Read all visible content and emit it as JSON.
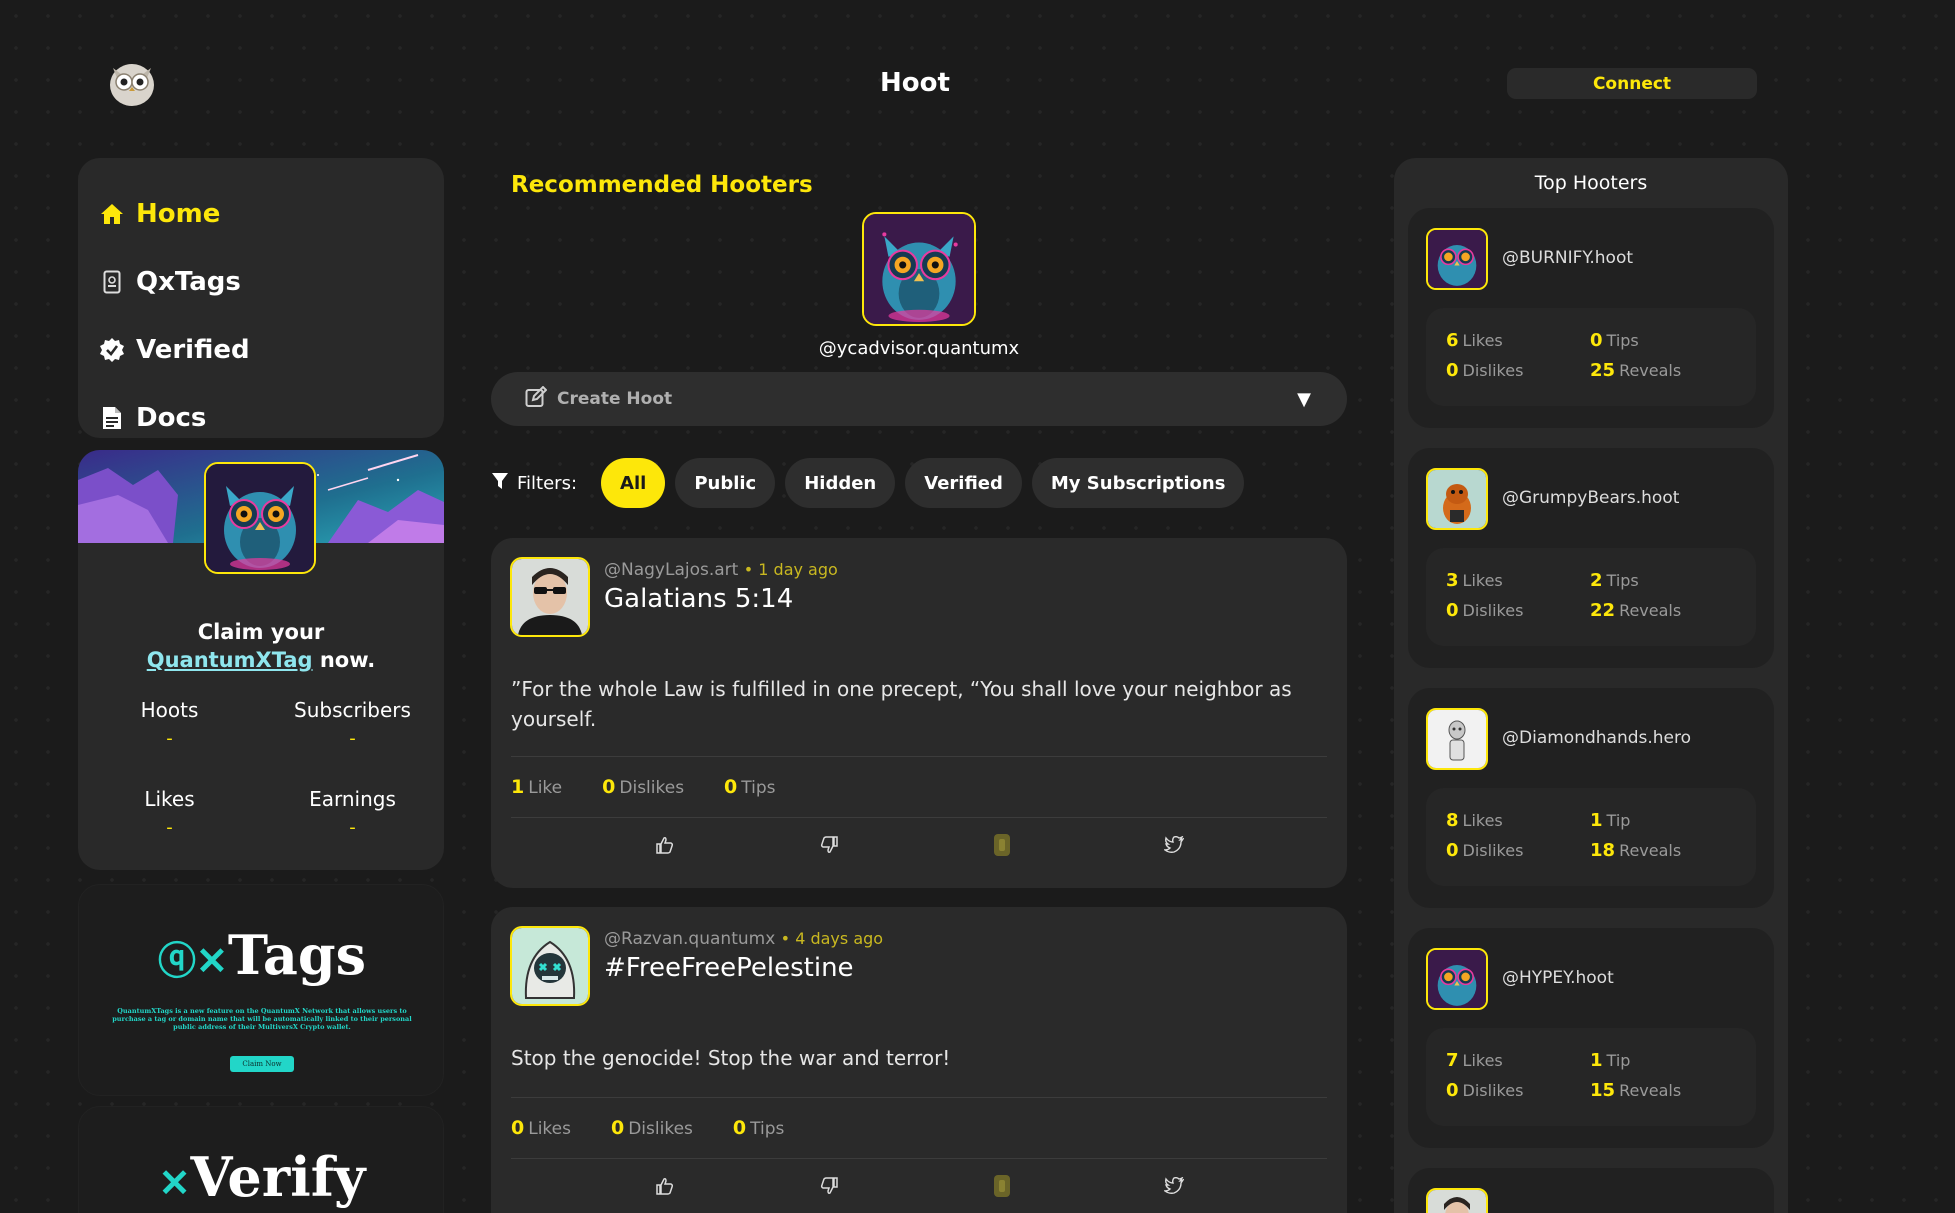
{
  "header": {
    "title": "Hoot",
    "connect_label": "Connect"
  },
  "nav": {
    "items": [
      {
        "label": "Home",
        "icon": "home-icon"
      },
      {
        "label": "QxTags",
        "icon": "id-badge-icon"
      },
      {
        "label": "Verified",
        "icon": "verified-badge-icon"
      },
      {
        "label": "Docs",
        "icon": "document-icon"
      }
    ]
  },
  "claim": {
    "prefix": "Claim your",
    "link": "QuantumXTag",
    "suffix": "now.",
    "stats": [
      {
        "label": "Hoots",
        "value": "-"
      },
      {
        "label": "Subscribers",
        "value": "-"
      },
      {
        "label": "Likes",
        "value": "-"
      },
      {
        "label": "Earnings",
        "value": "-"
      }
    ]
  },
  "promos": {
    "tags_title": "Tags",
    "tags_desc": "QuantumXTags is a new feature on the QuantumX Network that allows users to purchase a tag or domain name that will be automatically linked to their personal public address of their MultiversX Crypto wallet.",
    "tags_button": "Claim Now",
    "verify_title": "Verify"
  },
  "recommended": {
    "title": "Recommended Hooters",
    "handle": "@ycadvisor.quantumx"
  },
  "create": {
    "label": "Create Hoot",
    "chevron": "▼"
  },
  "filters": {
    "label": "Filters:",
    "options": [
      "All",
      "Public",
      "Hidden",
      "Verified",
      "My Subscriptions"
    ],
    "active": "All"
  },
  "posts": [
    {
      "handle": "@NagyLajos.art",
      "time": "• 1 day ago",
      "title": "Galatians 5:14",
      "body": "”For the whole Law is fulfilled in one precept, “You shall love your neighbor as yourself.",
      "likes": "1",
      "likes_label": "Like",
      "dislikes": "0",
      "dislikes_label": "Dislikes",
      "tips": "0",
      "tips_label": "Tips"
    },
    {
      "handle": "@Razvan.quantumx",
      "time": "• 4 days ago",
      "title": "#FreeFreePelestine",
      "body": "Stop the genocide! Stop the war and terror!",
      "likes": "0",
      "likes_label": "Likes",
      "dislikes": "0",
      "dislikes_label": "Dislikes",
      "tips": "0",
      "tips_label": "Tips"
    }
  ],
  "top": {
    "title": "Top Hooters",
    "hooters": [
      {
        "handle": "@BURNIFY.hoot",
        "likes": "6",
        "likes_label": "Likes",
        "tips": "0",
        "tips_label": "Tips",
        "dislikes": "0",
        "dislikes_label": "Dislikes",
        "reveals": "25",
        "reveals_label": "Reveals"
      },
      {
        "handle": "@GrumpyBears.hoot",
        "likes": "3",
        "likes_label": "Likes",
        "tips": "2",
        "tips_label": "Tips",
        "dislikes": "0",
        "dislikes_label": "Dislikes",
        "reveals": "22",
        "reveals_label": "Reveals"
      },
      {
        "handle": "@Diamondhands.hero",
        "likes": "8",
        "likes_label": "Likes",
        "tips": "1",
        "tips_label": "Tip",
        "dislikes": "0",
        "dislikes_label": "Dislikes",
        "reveals": "18",
        "reveals_label": "Reveals"
      },
      {
        "handle": "@HYPEY.hoot",
        "likes": "7",
        "likes_label": "Likes",
        "tips": "1",
        "tips_label": "Tip",
        "dislikes": "0",
        "dislikes_label": "Dislikes",
        "reveals": "15",
        "reveals_label": "Reveals"
      }
    ]
  },
  "colors": {
    "accent": "#fde70a",
    "panel": "#292929",
    "background": "#1b1b1b",
    "teal": "#22d6c8"
  }
}
